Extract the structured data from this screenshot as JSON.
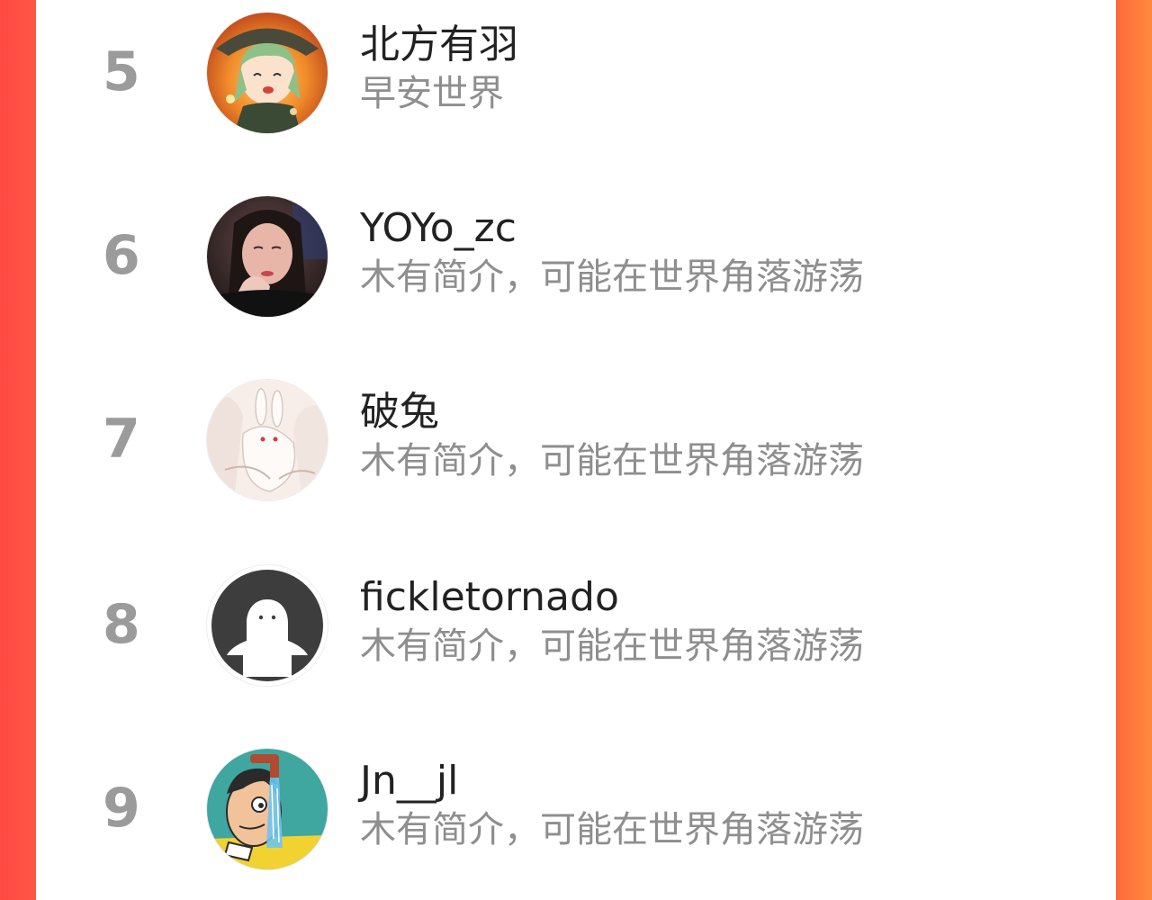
{
  "ranking": {
    "items": [
      {
        "rank": "5",
        "name": "北方有羽",
        "bio": "早安世界",
        "avatar": "anime-girl-avatar"
      },
      {
        "rank": "6",
        "name": "YOYo_zc",
        "bio": "木有简介，可能在世界角落游荡",
        "avatar": "photo-avatar"
      },
      {
        "rank": "7",
        "name": "破兔",
        "bio": "木有简介，可能在世界角落游荡",
        "avatar": "rabbit-illustration-avatar"
      },
      {
        "rank": "8",
        "name": "fickletornado",
        "bio": "木有简介，可能在世界角落游荡",
        "avatar": "default-ghost-avatar"
      },
      {
        "rank": "9",
        "name": "Jn__jl",
        "bio": "木有简介，可能在世界角落游荡",
        "avatar": "cartoon-faucet-avatar"
      }
    ]
  },
  "colors": {
    "background_left": "#ff4a44",
    "background_right": "#ff8a3e",
    "panel": "#ffffff",
    "rank_number": "#9b9b9b",
    "name_text": "#222222",
    "bio_text": "#8e8e8e"
  }
}
